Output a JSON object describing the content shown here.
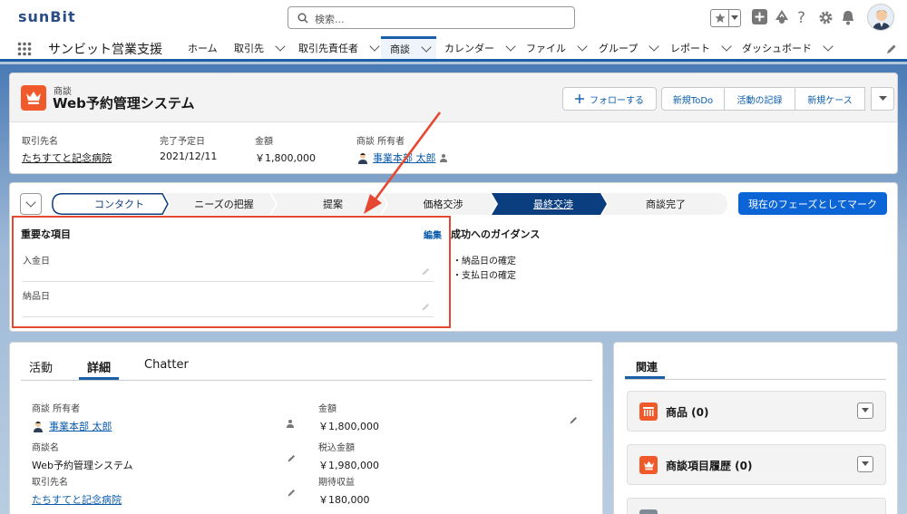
{
  "brand": {
    "logo": "sunBit"
  },
  "search": {
    "placeholder": "検索..."
  },
  "nav": {
    "app_name": "サンビット営業支援",
    "items": [
      {
        "label": "ホーム",
        "dropdown": false
      },
      {
        "label": "取引先",
        "dropdown": true
      },
      {
        "label": "取引先責任者",
        "dropdown": true
      },
      {
        "label": "商談",
        "dropdown": true,
        "selected": true
      },
      {
        "label": "カレンダー",
        "dropdown": true
      },
      {
        "label": "ファイル",
        "dropdown": true
      },
      {
        "label": "グループ",
        "dropdown": true
      },
      {
        "label": "レポート",
        "dropdown": true
      },
      {
        "label": "ダッシュボード",
        "dropdown": true
      }
    ]
  },
  "record": {
    "object_label": "商談",
    "name": "Web予約管理システム",
    "actions": {
      "follow": "フォローする",
      "new_todo": "新規ToDo",
      "log_activity": "活動の記録",
      "new_case": "新規ケース"
    },
    "highlights": [
      {
        "label": "取引先名",
        "value": "たちすてと記念病院",
        "link": true
      },
      {
        "label": "完了予定日",
        "value": "2021/12/11",
        "link": false
      },
      {
        "label": "金額",
        "value": "￥1,800,000",
        "link": false
      },
      {
        "label": "商談 所有者",
        "value": "事業本部 太郎",
        "link": true
      }
    ]
  },
  "path": {
    "stages": [
      {
        "label": "コンタクト",
        "state": "current"
      },
      {
        "label": "ニーズの把握",
        "state": "open"
      },
      {
        "label": "提案",
        "state": "open"
      },
      {
        "label": "価格交渉",
        "state": "open"
      },
      {
        "label": "最終交渉",
        "state": "selected"
      },
      {
        "label": "商談完了",
        "state": "open"
      }
    ],
    "mark_button": "現在のフェーズとしてマーク",
    "key_fields_title": "重要な項目",
    "edit_link": "編集",
    "key_fields": [
      {
        "label": "入金日",
        "value": ""
      },
      {
        "label": "納品日",
        "value": ""
      }
    ],
    "guidance_title": "成功へのガイダンス",
    "guidance_items": [
      "・納品日の確定",
      "・支払日の確定"
    ]
  },
  "detail": {
    "tabs": [
      "活動",
      "詳細",
      "Chatter"
    ],
    "selected_tab": "詳細",
    "left_fields": [
      {
        "label": "商談 所有者",
        "value": "事業本部 太郎",
        "link": true
      },
      {
        "label": "商談名",
        "value": "Web予約管理システム",
        "link": false
      },
      {
        "label": "取引先名",
        "value": "たちすてと記念病院",
        "link": true
      }
    ],
    "right_fields": [
      {
        "label": "金額",
        "value": "￥1,800,000"
      },
      {
        "label": "税込金額",
        "value": "￥1,980,000"
      },
      {
        "label": "期待収益",
        "value": "￥180,000"
      }
    ]
  },
  "related": {
    "tab": "関連",
    "lists": [
      {
        "title": "商品 (0)",
        "icon": "product-icon"
      },
      {
        "title": "商談項目履歴 (0)",
        "icon": "history-icon"
      }
    ]
  },
  "colors": {
    "brand": "#1b5fa8",
    "accent_orange": "#f05a2a",
    "highlight_red": "#e64730",
    "button_blue": "#0b65d6",
    "path_selected": "#0b3e7e"
  }
}
